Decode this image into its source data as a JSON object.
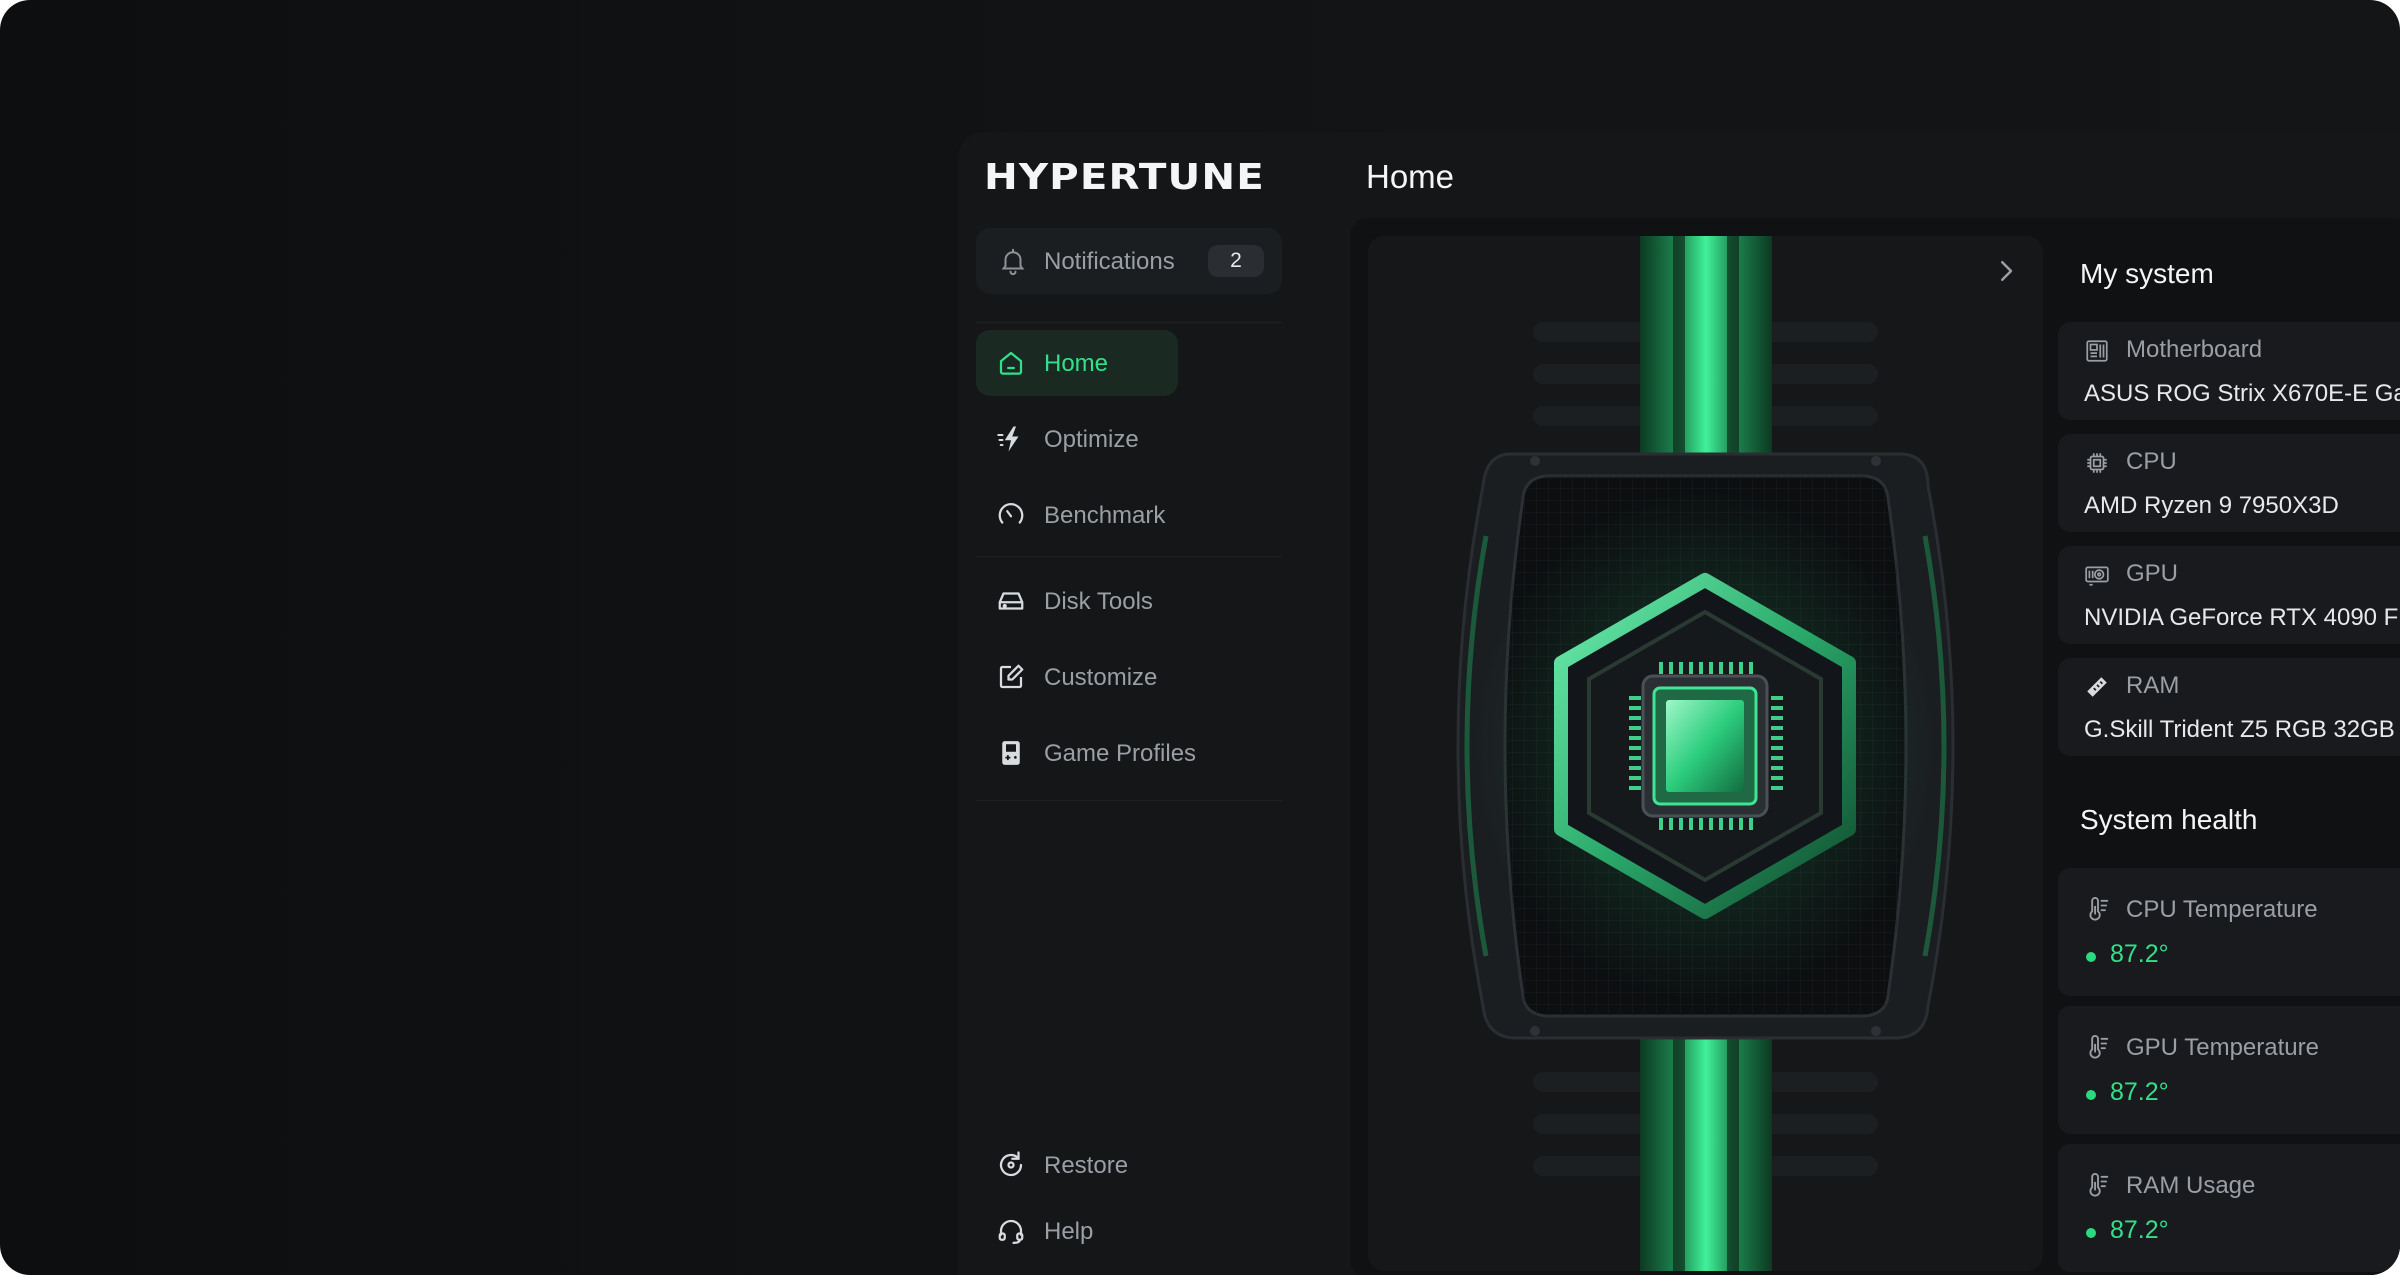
{
  "app": {
    "logo": "HYPERTUNE"
  },
  "header": {
    "title": "Home"
  },
  "sidebar": {
    "notifications": {
      "label": "Notifications",
      "count": "2"
    },
    "items": [
      {
        "label": "Home",
        "icon": "home-icon",
        "active": true
      },
      {
        "label": "Optimize",
        "icon": "bolt-icon"
      },
      {
        "label": "Benchmark",
        "icon": "gauge-icon"
      },
      {
        "label": "Disk Tools",
        "icon": "disk-icon"
      },
      {
        "label": "Customize",
        "icon": "edit-icon"
      },
      {
        "label": "Game Profiles",
        "icon": "gamepad-icon"
      }
    ],
    "footer": [
      {
        "label": "Restore",
        "icon": "restore-icon"
      },
      {
        "label": "Help",
        "icon": "headset-icon"
      }
    ]
  },
  "my_system": {
    "title": "My system",
    "items": [
      {
        "name": "Motherboard",
        "value": "ASUS ROG Strix X670E-E Ga"
      },
      {
        "name": "CPU",
        "value": "AMD Ryzen 9 7950X3D"
      },
      {
        "name": "GPU",
        "value": "NVIDIA GeForce RTX 4090 F"
      },
      {
        "name": "RAM",
        "value": "G.Skill Trident Z5 RGB 32GB"
      }
    ]
  },
  "system_health": {
    "title": "System health",
    "items": [
      {
        "name": "CPU Temperature",
        "value": "87.2°"
      },
      {
        "name": "GPU Temperature",
        "value": "87.2°"
      },
      {
        "name": "RAM Usage",
        "value": "87.2°"
      }
    ]
  },
  "colors": {
    "accent": "#33e08a",
    "background": "#111315",
    "panel": "#181a1d"
  }
}
